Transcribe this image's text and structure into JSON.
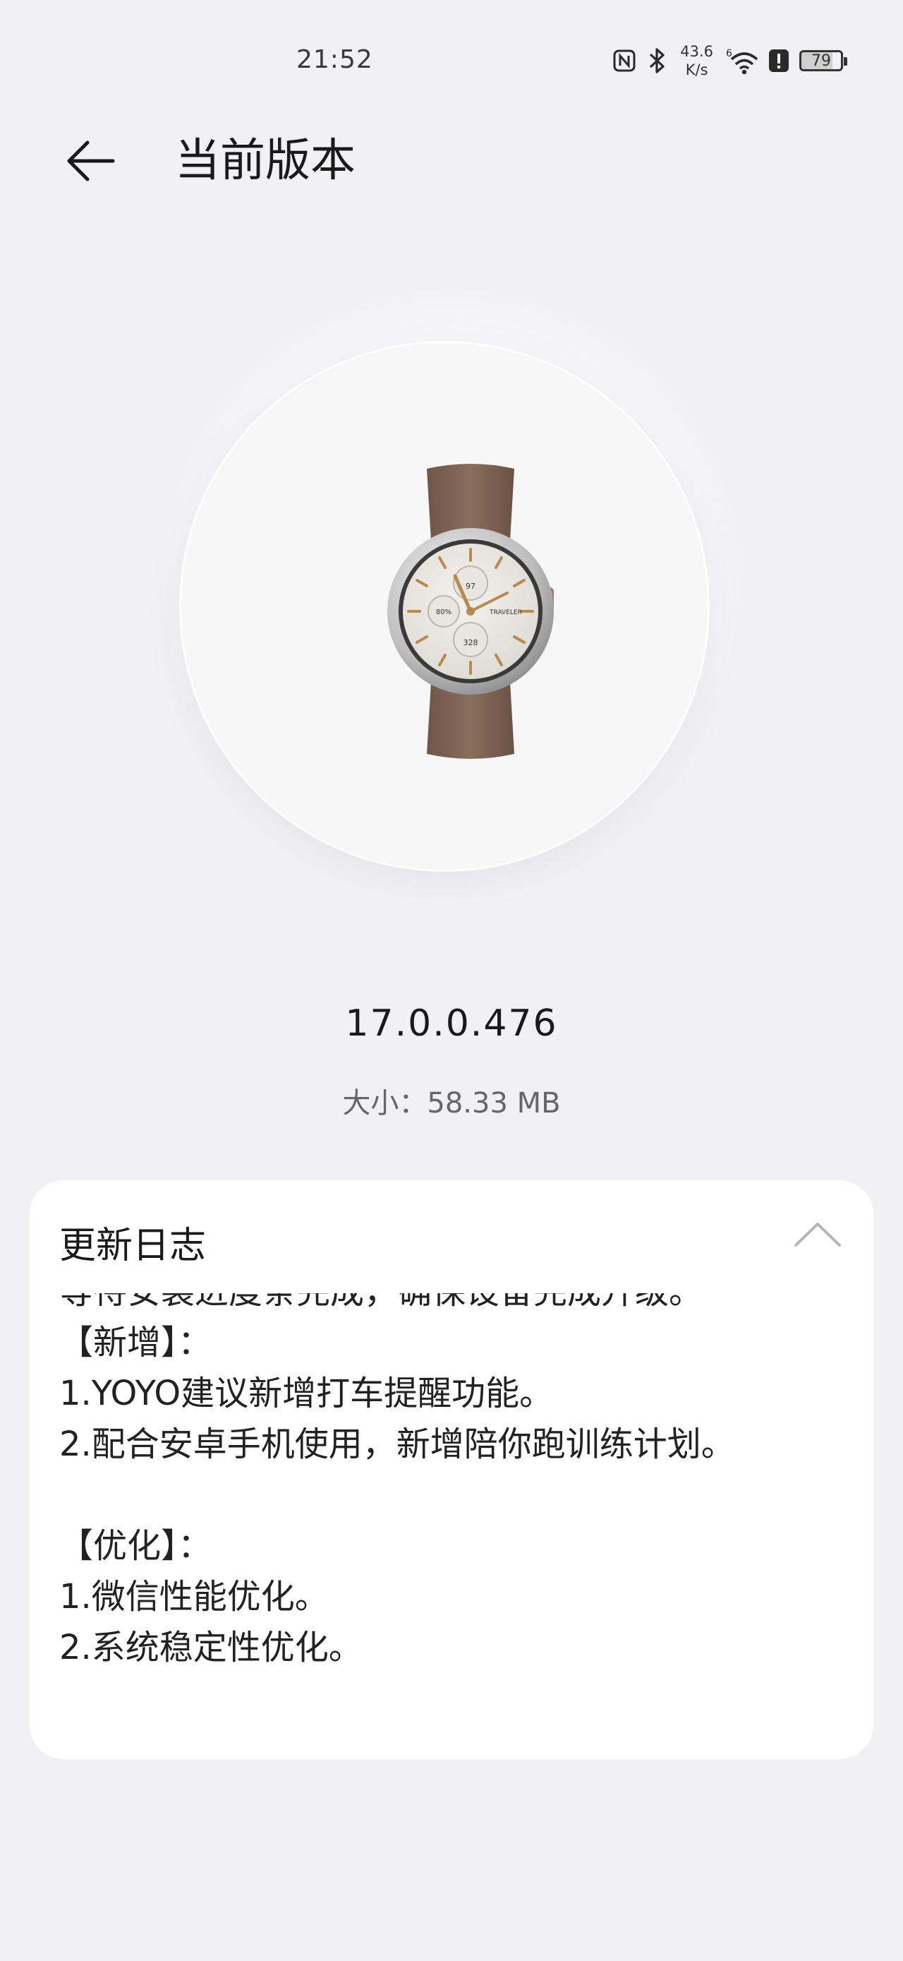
{
  "status_bar": {
    "time": "21:52",
    "net_speed_value": "43.6",
    "net_speed_unit": "K/s",
    "battery_level": "79",
    "icons": [
      "nfc-icon",
      "bluetooth-icon",
      "wifi-6-icon",
      "alert-icon",
      "battery-icon"
    ]
  },
  "header": {
    "title": "当前版本",
    "back_icon": "arrow-left-icon"
  },
  "device": {
    "image_icon": "smartwatch-image"
  },
  "version_info": {
    "version": "17.0.0.476",
    "size": "大小：58.33 MB"
  },
  "changelog": {
    "title": "更新日志",
    "collapse_icon": "chevron-up-icon",
    "cut_line": "等待安装进度条完成，确保设备完成升级。",
    "new_header": "【新增】：",
    "new_items": [
      "1.YOYO建议新增打车提醒功能。",
      "2.配合安卓手机使用，新增陪你跑训练计划。"
    ],
    "opt_header": "【优化】：",
    "opt_items": [
      "1.微信性能优化。",
      "2.系统稳定性优化。"
    ]
  }
}
